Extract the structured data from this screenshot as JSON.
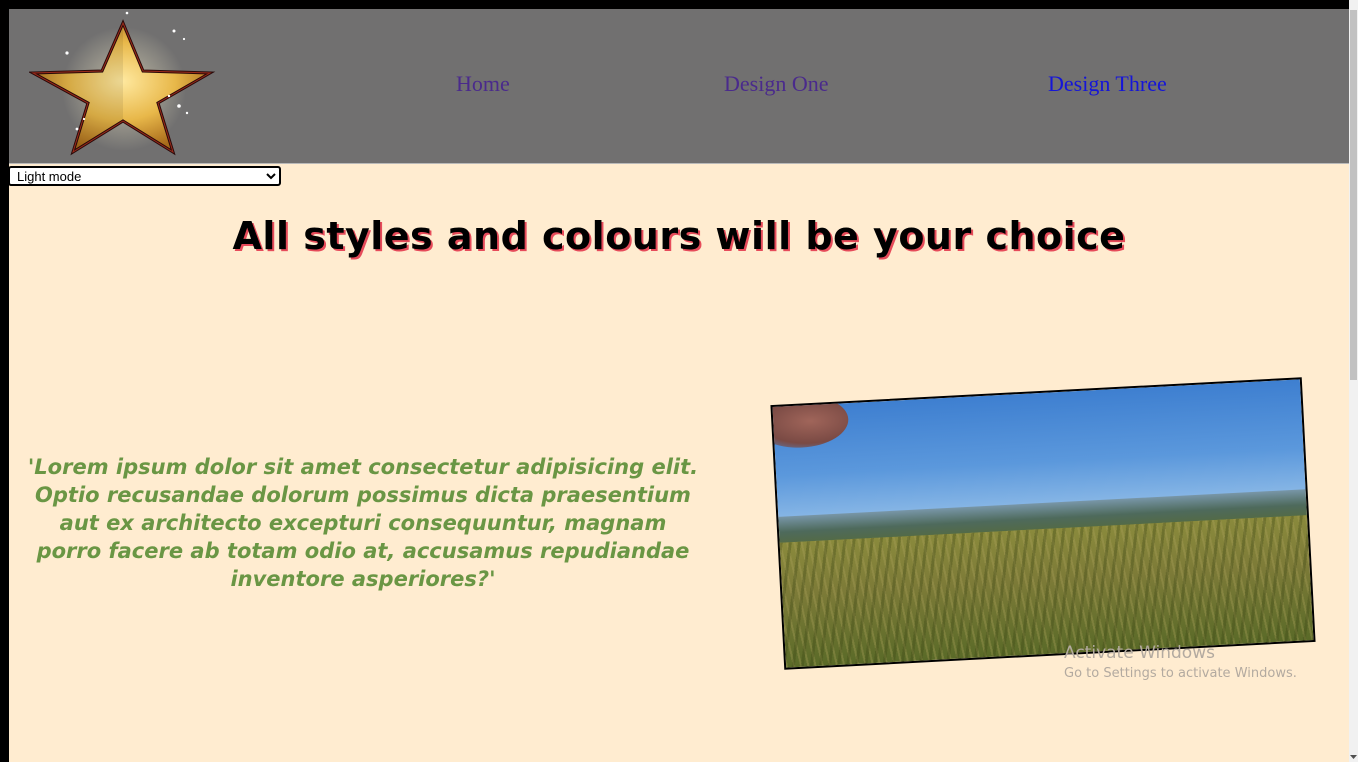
{
  "nav": {
    "home": "Home",
    "design_one": "Design One",
    "design_three": "Design Three"
  },
  "mode_select": {
    "selected": "Light mode",
    "options": [
      "Light mode"
    ]
  },
  "main": {
    "headline": "All styles and colours will be your choice",
    "quote": "'Lorem ipsum dolor sit amet consectetur adipisicing elit. Optio recusandae dolorum possimus dicta praesentium aut ex architecto excepturi consequuntur, magnam porro facere ab totam odio at, accusamus repudiandae inventore asperiores?'"
  },
  "watermark": {
    "title": "Activate Windows",
    "subtitle": "Go to Settings to activate Windows."
  },
  "colors": {
    "header_bg": "#717070",
    "page_bg": "#ffecd0",
    "quote": "#6a9644",
    "headline_shadow": "#e64b5a",
    "link_visited": "#4a2a8c",
    "link": "#1515d8"
  },
  "icons": {
    "logo": "gold-star-logo"
  }
}
